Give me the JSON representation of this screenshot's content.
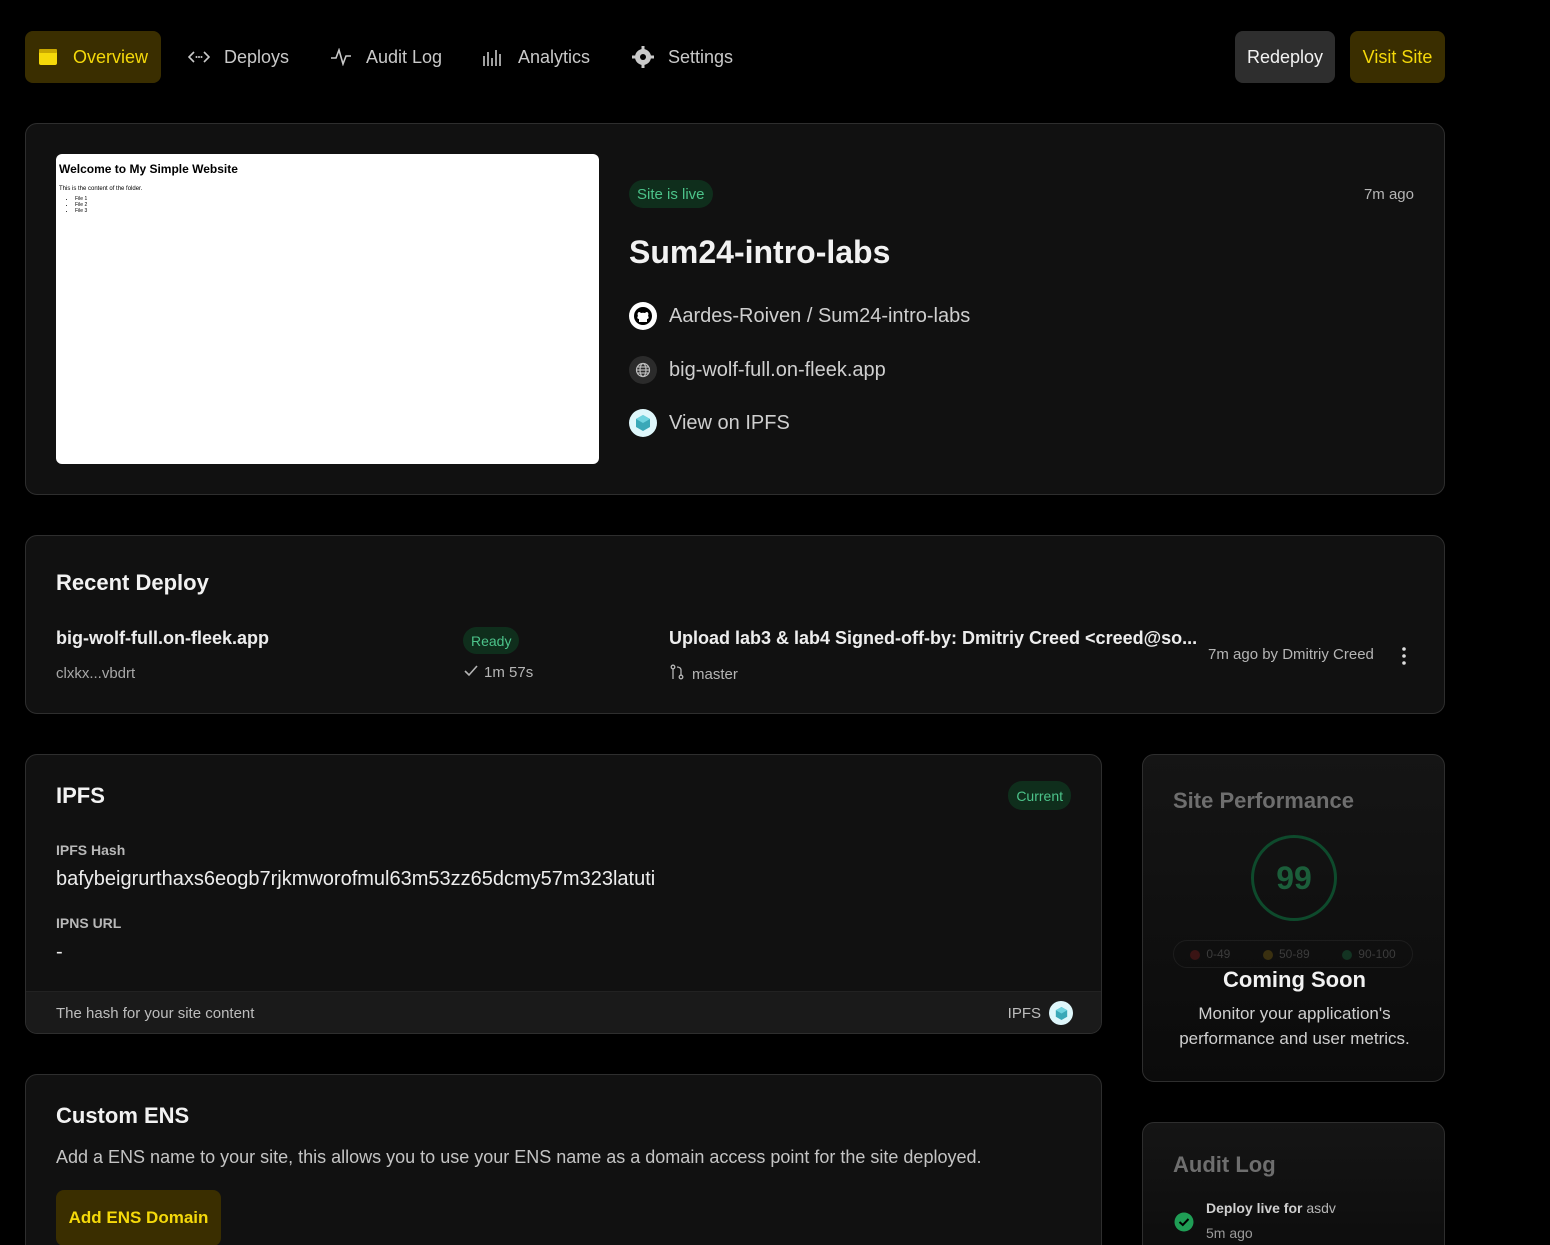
{
  "nav": {
    "items": [
      {
        "label": "Overview",
        "icon": "browser-window-icon"
      },
      {
        "label": "Deploys",
        "icon": "code-arrows-icon"
      },
      {
        "label": "Audit Log",
        "icon": "activity-pulse-icon"
      },
      {
        "label": "Analytics",
        "icon": "bars-icon"
      },
      {
        "label": "Settings",
        "icon": "gear-icon"
      }
    ],
    "redeploy": "Redeploy",
    "visit": "Visit Site"
  },
  "hero": {
    "preview": {
      "heading": "Welcome to My Simple Website",
      "text": "This is the content of the folder.",
      "files": [
        "File 1",
        "File 2",
        "File 3"
      ]
    },
    "status": "Site is live",
    "time": "7m ago",
    "title": "Sum24-intro-labs",
    "repo": "Aardes-Roiven / Sum24-intro-labs",
    "domain": "big-wolf-full.on-fleek.app",
    "ipfs_link": "View on IPFS"
  },
  "recent_deploy": {
    "title": "Recent Deploy",
    "domain": "big-wolf-full.on-fleek.app",
    "id": "clxkx...vbdrt",
    "status": "Ready",
    "duration": "1m 57s",
    "commit": "Upload lab3 & lab4 Signed-off-by: Dmitriy Creed <creed@so...",
    "branch": "master",
    "meta": "7m ago by Dmitriy Creed"
  },
  "ipfs": {
    "title": "IPFS",
    "badge": "Current",
    "hash_label": "IPFS Hash",
    "hash": "bafybeigrurthaxs6eogb7rjkmworofmul63m53zz65dcmy57m323latuti",
    "ipns_label": "IPNS URL",
    "ipns": "-",
    "footer": "The hash for your site content",
    "footer_right": "IPFS"
  },
  "ens": {
    "title": "Custom ENS",
    "desc": "Add a ENS name to your site, this allows you to use your ENS name as a domain access point for the site deployed.",
    "button": "Add ENS Domain"
  },
  "performance": {
    "title": "Site Performance",
    "score": "99",
    "legend": [
      "0-49",
      "50-89",
      "90-100"
    ],
    "coming": "Coming Soon",
    "desc": "Monitor your application's performance and user metrics."
  },
  "audit": {
    "title": "Audit Log",
    "entry_bold": "Deploy live for",
    "entry_target": "asdv",
    "entry_time": "5m ago"
  },
  "colors": {
    "accent_yellow": "#f5d90a",
    "green": "#4cc38a",
    "bg": "#000000",
    "card": "#111111"
  }
}
